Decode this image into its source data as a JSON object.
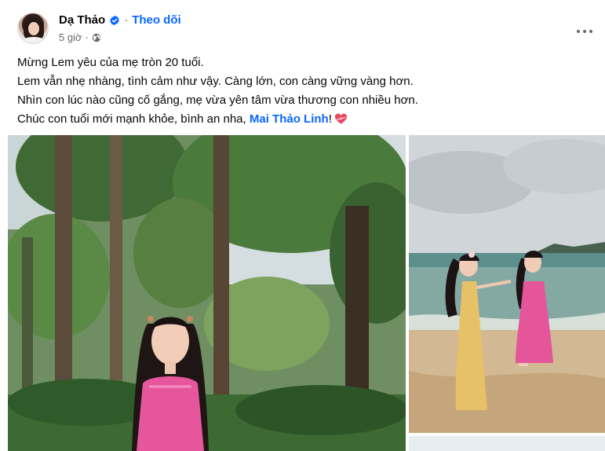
{
  "post": {
    "author": "Dạ Thảo",
    "separator": "·",
    "follow_label": "Theo dõi",
    "timestamp": "5 giờ",
    "meta_separator": "·",
    "privacy_icon": "globe-icon",
    "verified_icon": "verified-badge-icon",
    "more_icon": "more-options-icon",
    "text_lines": [
      "Mừng Lem yêu của mẹ tròn 20 tuổi.",
      "Lem vẫn nhẹ nhàng, tình cảm như vậy. Càng lớn, con càng vững vàng hơn.",
      "Nhìn con lúc nào cũng cố gắng, mẹ vừa yên tâm vừa thương con nhiều hơn."
    ],
    "last_line_prefix": "Chúc con tuổi mới mạnh khỏe, bình an nha, ",
    "mention": "Mai Thảo Linh",
    "last_line_suffix": "!",
    "emoji": "heart-with-ribbon-icon"
  },
  "colors": {
    "link_blue": "#0866ff",
    "secondary_text": "#65676b",
    "primary_text": "#050505"
  }
}
